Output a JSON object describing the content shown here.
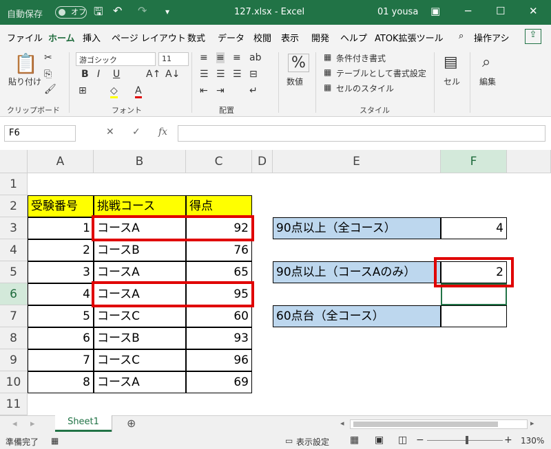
{
  "titlebar": {
    "autosave_label": "自動保存",
    "autosave_state": "オフ",
    "title": "127.xlsx  -  Excel",
    "user": "01 yousa",
    "accent_color": "#217346"
  },
  "tabs": [
    "ファイル",
    "ホーム",
    "挿入",
    "ページ レイアウト",
    "数式",
    "データ",
    "校閲",
    "表示",
    "開発",
    "ヘルプ",
    "ATOK拡張ツール",
    "操作アシ"
  ],
  "active_tab": "ホーム",
  "ribbon": {
    "paste_label": "貼り付け",
    "clipboard_label": "クリップボード",
    "font_name": "游ゴシック",
    "font_size": "11",
    "font_group_label": "フォント",
    "align_group_label": "配置",
    "number_label": "数値",
    "conditional_format": "条件付き書式",
    "format_as_table": "テーブルとして書式設定",
    "cell_styles": "セルのスタイル",
    "style_group_label": "スタイル",
    "cells_label": "セル",
    "editing_label": "編集"
  },
  "formula_bar": {
    "name_box": "F6",
    "formula": ""
  },
  "columns": [
    "A",
    "B",
    "C",
    "D",
    "E",
    "F"
  ],
  "rows": [
    "1",
    "2",
    "3",
    "4",
    "5",
    "6",
    "7",
    "8",
    "9",
    "10",
    "11"
  ],
  "table": {
    "headers": [
      "受験番号",
      "挑戦コース",
      "得点"
    ],
    "data": [
      [
        "1",
        "コースA",
        "92"
      ],
      [
        "2",
        "コースB",
        "76"
      ],
      [
        "3",
        "コースA",
        "65"
      ],
      [
        "4",
        "コースA",
        "95"
      ],
      [
        "5",
        "コースC",
        "60"
      ],
      [
        "6",
        "コースB",
        "93"
      ],
      [
        "7",
        "コースC",
        "96"
      ],
      [
        "8",
        "コースA",
        "69"
      ]
    ]
  },
  "summary": [
    {
      "label": "90点以上（全コース）",
      "value": "4"
    },
    {
      "label": "90点以上（コースAのみ）",
      "value": "2"
    },
    {
      "label": "60点台（全コース）",
      "value": ""
    }
  ],
  "sheet": {
    "tab": "Sheet1"
  },
  "status": {
    "ready": "準備完了",
    "display_settings": "表示設定",
    "zoom": "130%"
  }
}
